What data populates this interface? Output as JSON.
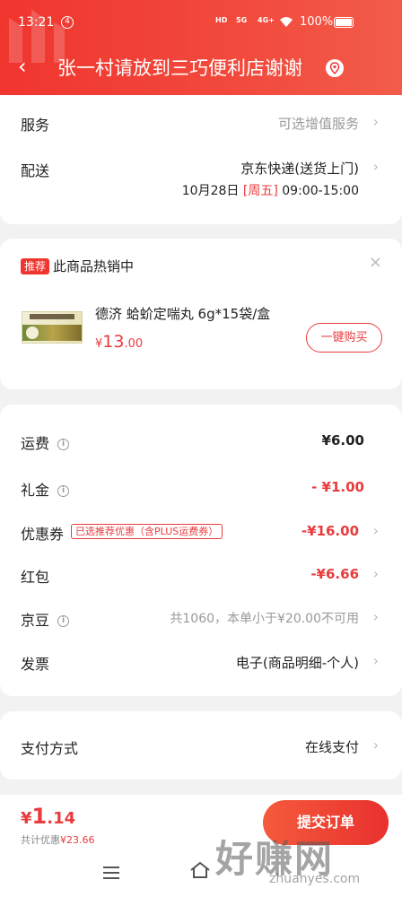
{
  "status_bar": {
    "time": "13:21",
    "notification_count": "4",
    "network": [
      "HD",
      "5G",
      "4G+"
    ],
    "battery": "100%"
  },
  "header": {
    "title": "张一村请放到三巧便利店谢谢",
    "icons": {
      "back": "chevron-left-icon",
      "location": "location-pin-icon"
    }
  },
  "delivery": {
    "service_label": "服务",
    "service_value": "可选增值服务",
    "shipping_label": "配送",
    "shipping_value": "京东快递(送货上门)",
    "shipping_date": "10月28日",
    "shipping_weekday": "[周五]",
    "shipping_time": "09:00-15:00"
  },
  "recommend": {
    "tag": "推荐",
    "text": "此商品热销中",
    "close": "×",
    "product_name": "德济  蛤蚧定喘丸  6g*15袋/盒",
    "price_symbol": "¥",
    "price_int": "13",
    "price_dec": ".00",
    "buy_label": "一键购买"
  },
  "fees": {
    "freight_label": "运费",
    "freight_value": "¥6.00",
    "gift_label": "礼金",
    "gift_value": "- ¥1.00",
    "coupon_label": "优惠券",
    "coupon_badge": "已选推荐优惠（含PLUS运费券）",
    "coupon_value": "-¥16.00",
    "redpacket_label": "红包",
    "redpacket_value": "-¥6.66",
    "jingdou_label": "京豆",
    "jingdou_value": "共1060，本单小于¥20.00不可用",
    "invoice_label": "发票",
    "invoice_value": "电子(商品明细-个人)"
  },
  "payment": {
    "label": "支付方式",
    "value": "在线支付"
  },
  "bottom": {
    "total_symbol": "¥",
    "total_int": "1",
    "total_dec": ".14",
    "saving_label": "共计优惠",
    "saving_value": "¥23.66",
    "submit_label": "提交订单"
  },
  "watermark": {
    "big": "好赚网",
    "small": "zhuanyes.com"
  },
  "colors": {
    "brand_red": "#f0352e",
    "price_red": "#e93b3d",
    "weekday_blue": "#1a73e8"
  }
}
